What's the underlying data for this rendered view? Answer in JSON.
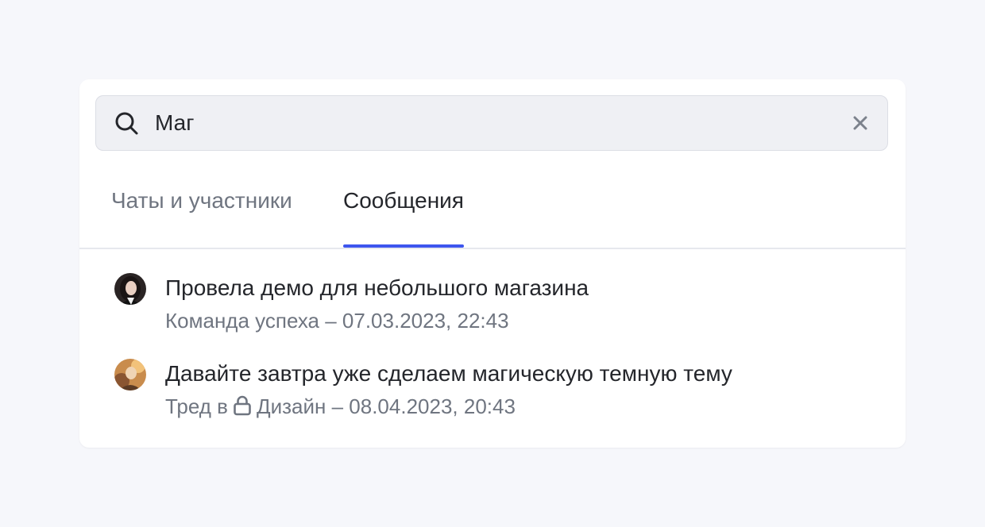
{
  "search": {
    "value": "Маг",
    "placeholder": ""
  },
  "tabs": [
    {
      "label": "Чаты и участники",
      "active": false
    },
    {
      "label": "Сообщения",
      "active": true
    }
  ],
  "results": [
    {
      "title": "Провела демо для небольшого магазина",
      "meta": "Команда успеха – 07.03.2023, 22:43"
    },
    {
      "title": "Давайте завтра уже сделаем магическую темную тему",
      "meta_prefix": "Тред в",
      "meta_rest": "Дизайн – 08.04.2023, 20:43"
    }
  ],
  "colors": {
    "background": "#f6f7fb",
    "panel": "#ffffff",
    "search_bg": "#eff0f4",
    "accent": "#3d55ee",
    "text_primary": "#24262b",
    "text_secondary": "#6f7580"
  },
  "icons": {
    "search": "search-icon",
    "clear": "close-icon",
    "lock": "lock-icon"
  }
}
